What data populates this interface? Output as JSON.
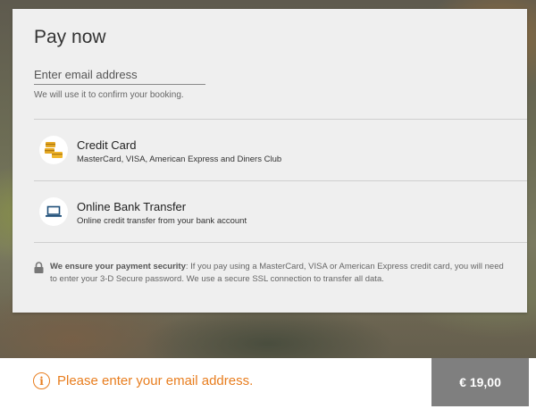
{
  "title": "Pay now",
  "email": {
    "value": "",
    "placeholder": "Enter email address",
    "helper": "We will use it to confirm your booking."
  },
  "payment_options": [
    {
      "title": "Credit Card",
      "subtitle": "MasterCard, VISA, American Express and Diners Club",
      "icon": "credit-cards-icon"
    },
    {
      "title": "Online Bank Transfer",
      "subtitle": "Online credit transfer from your bank account",
      "icon": "laptop-icon"
    }
  ],
  "security": {
    "bold": "We ensure your payment security",
    "text": ": If you pay using a MasterCard, VISA or American Express credit card, you will need to enter your 3-D Secure password. We use a secure SSL connection to transfer all data.",
    "icon": "lock-icon"
  },
  "alert": {
    "icon": "info-icon",
    "symbol": "i",
    "text": "Please enter your email address."
  },
  "price": "€ 19,00",
  "colors": {
    "accent": "#e87d1e",
    "card_icon_gold": "#e5a823",
    "laptop_blue": "#1f4f7a",
    "price_bg": "#7f7f7f"
  }
}
